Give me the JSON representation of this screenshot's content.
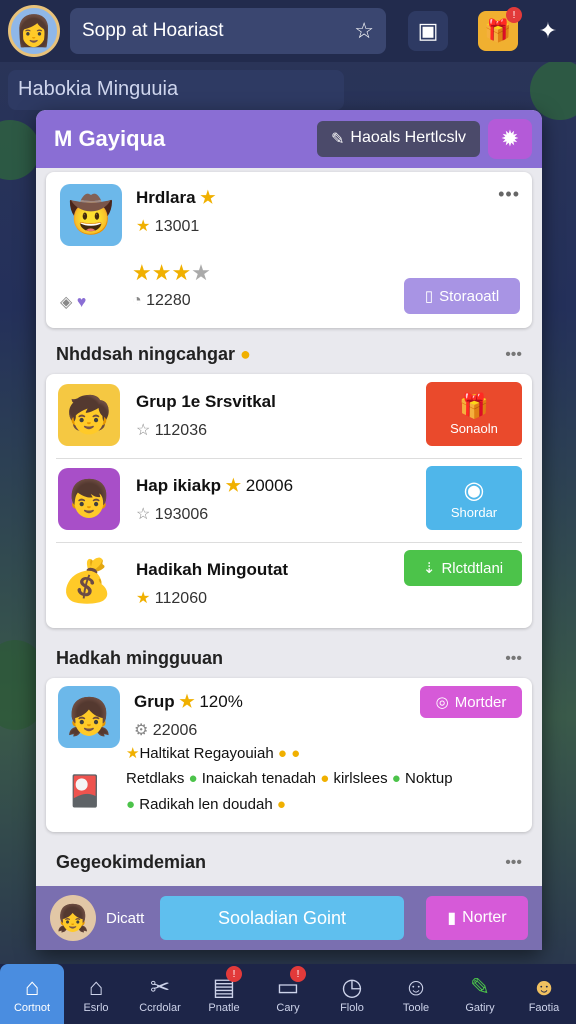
{
  "topbar": {
    "search_text": "Sopp at Hoariast",
    "badge_1": "!",
    "badge_2": "!"
  },
  "background": {
    "header": "Habokia Minguuia"
  },
  "panel": {
    "title": "M Gayiqua",
    "pill_label": "Haoals Hertlcslv",
    "profile": {
      "name": "Hrdlara",
      "score": "13001",
      "stars": 3,
      "stars_max": 4,
      "coins": "12280",
      "action": "Storaoatl"
    },
    "section1": {
      "title": "Nhddsah ningcahgar"
    },
    "groups": [
      {
        "name": "Grup 1e Srsvitkal",
        "score": "112036",
        "action": "Sonaoln"
      },
      {
        "name": "Hap ikiakp",
        "extra": "20006",
        "score": "193006",
        "action": "Shordar"
      },
      {
        "name": "Hadikah Mingoutat",
        "score": "112060",
        "action": "Rlctdtlani"
      }
    ],
    "section2": {
      "title": "Hadkah mingguuan"
    },
    "weekly": {
      "name": "Grup",
      "percent": "120%",
      "score": "22006",
      "action": "Mortder",
      "line1": "Haltikat Regayouiah",
      "line2a": "Retdlaks",
      "line2b": "Inaickah tenadah",
      "line2c": "kirlslees",
      "line2d": "Noktup",
      "line3": "Radikah len doudah"
    },
    "section3": {
      "title": "Gegeokimdemian"
    }
  },
  "footer": {
    "label": "Dicatt",
    "primary": "Sooladian Goint",
    "secondary": "Norter"
  },
  "nav": [
    {
      "label": "Cortnot",
      "icon": "home-icon"
    },
    {
      "label": "Esrlo",
      "icon": "house-icon"
    },
    {
      "label": "Ccrdolar",
      "icon": "tools-icon"
    },
    {
      "label": "Pnatle",
      "icon": "inbox-icon"
    },
    {
      "label": "Cary",
      "icon": "chest-icon"
    },
    {
      "label": "Flolo",
      "icon": "clock-icon"
    },
    {
      "label": "Toole",
      "icon": "chat-icon"
    },
    {
      "label": "Gatiry",
      "icon": "pencil-icon"
    },
    {
      "label": "Faotia",
      "icon": "face-icon"
    }
  ],
  "colors": {
    "accent": "#8a6ed4",
    "green": "#4cc34a",
    "red": "#ea4a2c",
    "blue": "#4fb6ea",
    "pink": "#d65ad8"
  }
}
